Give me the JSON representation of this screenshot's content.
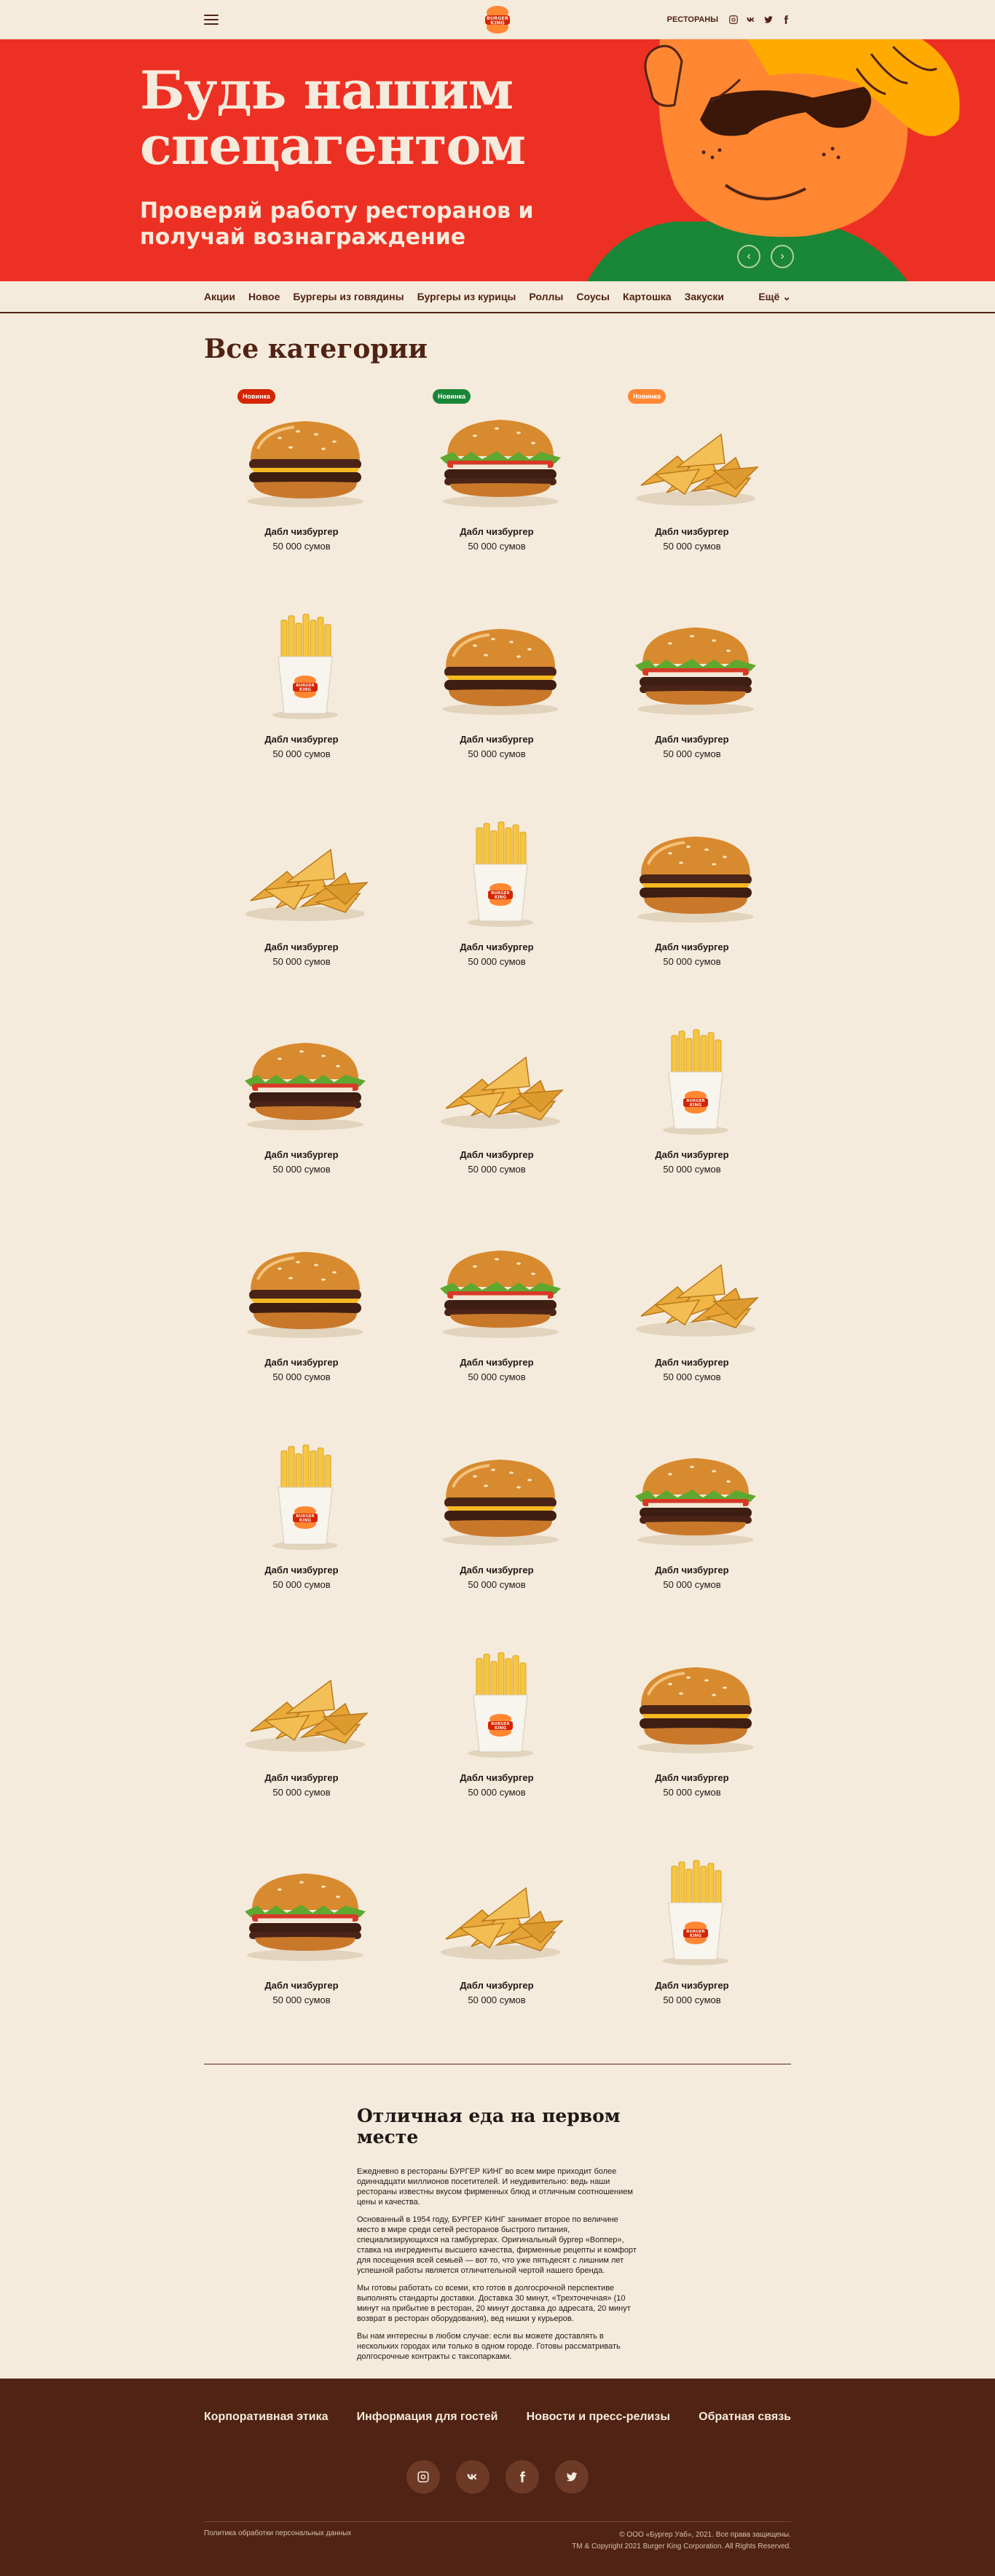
{
  "header": {
    "restaurants_label": "РЕСТОРАНЫ",
    "logo_text": "BURGER KING"
  },
  "hero": {
    "title_line1": "Будь нашим",
    "title_line2": "спецагентом",
    "subtitle": "Проверяй работу ресторанов и получай вознаграждение",
    "prev": "‹",
    "next": "›"
  },
  "catnav": {
    "items": [
      "Акции",
      "Новое",
      "Бургеры из говядины",
      "Бургеры из курицы",
      "Роллы",
      "Соусы",
      "Картошка",
      "Закуски"
    ],
    "more": "Ещё"
  },
  "section": {
    "title": "Все категории"
  },
  "badges": {
    "new": "Новинка",
    "colors": {
      "red": "#d62300",
      "green": "#198737",
      "orange": "#ff8732"
    }
  },
  "products": [
    {
      "name": "Дабл чизбургер",
      "price": "50 000 сумов",
      "type": "whopper",
      "badge": "red"
    },
    {
      "name": "Дабл чизбургер",
      "price": "50 000 сумов",
      "type": "whopper-lettuce",
      "badge": "green"
    },
    {
      "name": "Дабл чизбургер",
      "price": "50 000 сумов",
      "type": "wedges",
      "badge": "orange"
    },
    {
      "name": "Дабл чизбургер",
      "price": "50 000 сумов",
      "type": "fries",
      "badge": ""
    },
    {
      "name": "Дабл чизбургер",
      "price": "50 000 сумов",
      "type": "whopper",
      "badge": ""
    },
    {
      "name": "Дабл чизбургер",
      "price": "50 000 сумов",
      "type": "whopper-lettuce",
      "badge": ""
    },
    {
      "name": "Дабл чизбургер",
      "price": "50 000 сумов",
      "type": "wedges",
      "badge": ""
    },
    {
      "name": "Дабл чизбургер",
      "price": "50 000 сумов",
      "type": "fries",
      "badge": ""
    },
    {
      "name": "Дабл чизбургер",
      "price": "50 000 сумов",
      "type": "whopper",
      "badge": ""
    },
    {
      "name": "Дабл чизбургер",
      "price": "50 000 сумов",
      "type": "whopper-lettuce",
      "badge": ""
    },
    {
      "name": "Дабл чизбургер",
      "price": "50 000 сумов",
      "type": "wedges",
      "badge": ""
    },
    {
      "name": "Дабл чизбургер",
      "price": "50 000 сумов",
      "type": "fries",
      "badge": ""
    },
    {
      "name": "Дабл чизбургер",
      "price": "50 000 сумов",
      "type": "whopper",
      "badge": ""
    },
    {
      "name": "Дабл чизбургер",
      "price": "50 000 сумов",
      "type": "whopper-lettuce",
      "badge": ""
    },
    {
      "name": "Дабл чизбургер",
      "price": "50 000 сумов",
      "type": "wedges",
      "badge": ""
    },
    {
      "name": "Дабл чизбургер",
      "price": "50 000 сумов",
      "type": "fries",
      "badge": ""
    },
    {
      "name": "Дабл чизбургер",
      "price": "50 000 сумов",
      "type": "whopper",
      "badge": ""
    },
    {
      "name": "Дабл чизбургер",
      "price": "50 000 сумов",
      "type": "whopper-lettuce",
      "badge": ""
    },
    {
      "name": "Дабл чизбургер",
      "price": "50 000 сумов",
      "type": "wedges",
      "badge": ""
    },
    {
      "name": "Дабл чизбургер",
      "price": "50 000 сумов",
      "type": "fries",
      "badge": ""
    },
    {
      "name": "Дабл чизбургер",
      "price": "50 000 сумов",
      "type": "whopper",
      "badge": ""
    },
    {
      "name": "Дабл чизбургер",
      "price": "50 000 сумов",
      "type": "whopper-lettuce",
      "badge": ""
    },
    {
      "name": "Дабл чизбургер",
      "price": "50 000 сумов",
      "type": "wedges",
      "badge": ""
    },
    {
      "name": "Дабл чизбургер",
      "price": "50 000 сумов",
      "type": "fries",
      "badge": ""
    }
  ],
  "about": {
    "title": "Отличная еда на первом месте",
    "paragraphs": [
      "Ежедневно в рестораны БУРГЕР КИНГ во всем мире приходит более одиннадцати миллионов посетителей. И неудивительно: ведь наши рестораны известны вкусом фирменных блюд и отличным соотношением цены и качества.",
      "Основанный в 1954 году, БУРГЕР КИНГ занимает второе по величине место в мире среди сетей ресторанов быстрого питания, специализирующихся на гамбургерах. Оригинальный бургер «Воппер», ставка на ингредиенты высшего качества, фирменные рецепты и комфорт для посещения всей семьей — вот то, что уже пятьдесят с лишним лет успешной работы является отличительной чертой нашего бренда.",
      "Мы готовы работать со всеми, кто готов в долгосрочной перспективе выполнять стандарты доставки. Доставка 30 минут, «Трехточечная» (10 минут на прибытие в ресторан, 20 минут доставка до адресата, 20 минут возврат в ресторан оборудования), вед нишки у курьеров.",
      "Вы нам интересны в любом случае: если вы можете доставлять в нескольких городах или только в одном городе. Готовы рассматривать долгосрочные контракты с таксопарками."
    ]
  },
  "footer": {
    "links": [
      "Корпоративная этика",
      "Информация для гостей",
      "Новости и пресс-релизы",
      "Обратная связь"
    ],
    "policy": "Политика обработки персональных данных",
    "copyright1": "© ООО «Бургер Уаб», 2021. Все права защищены.",
    "copyright2": "TM & Copyright 2021 Burger King Corporation. All Rights Reserved."
  }
}
